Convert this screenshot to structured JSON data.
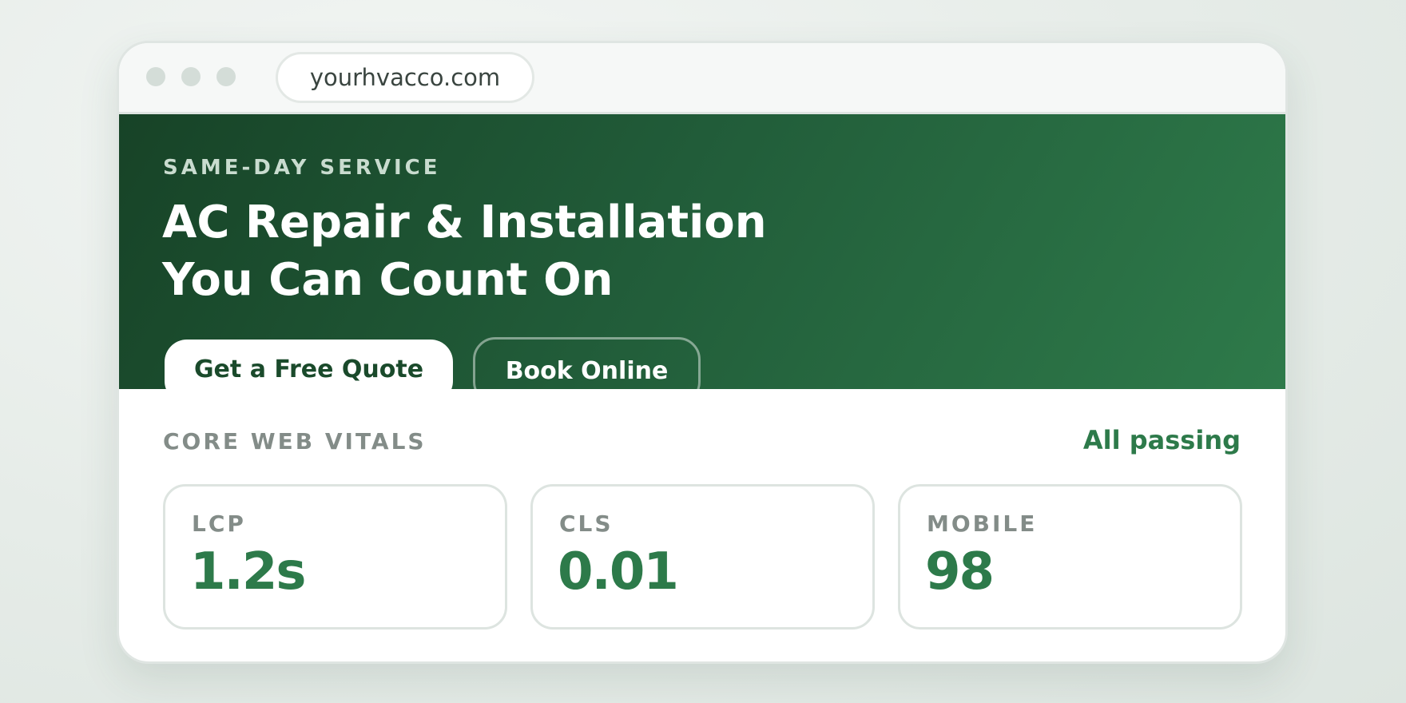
{
  "browser": {
    "url": "yourhvacco.com"
  },
  "hero": {
    "eyebrow": "SAME-DAY SERVICE",
    "headline_line1": "AC Repair & Installation",
    "headline_line2": "You Can Count On",
    "primary_cta": "Get a Free Quote",
    "secondary_cta": "Book Online"
  },
  "vitals": {
    "title": "CORE WEB VITALS",
    "status": "All passing",
    "cards": [
      {
        "label": "LCP",
        "value": "1.2s"
      },
      {
        "label": "CLS",
        "value": "0.01"
      },
      {
        "label": "MOBILE",
        "value": "98"
      }
    ]
  },
  "colors": {
    "brand_dark": "#174327",
    "brand_accent": "#2d7a4a",
    "muted_text": "#838c88"
  }
}
